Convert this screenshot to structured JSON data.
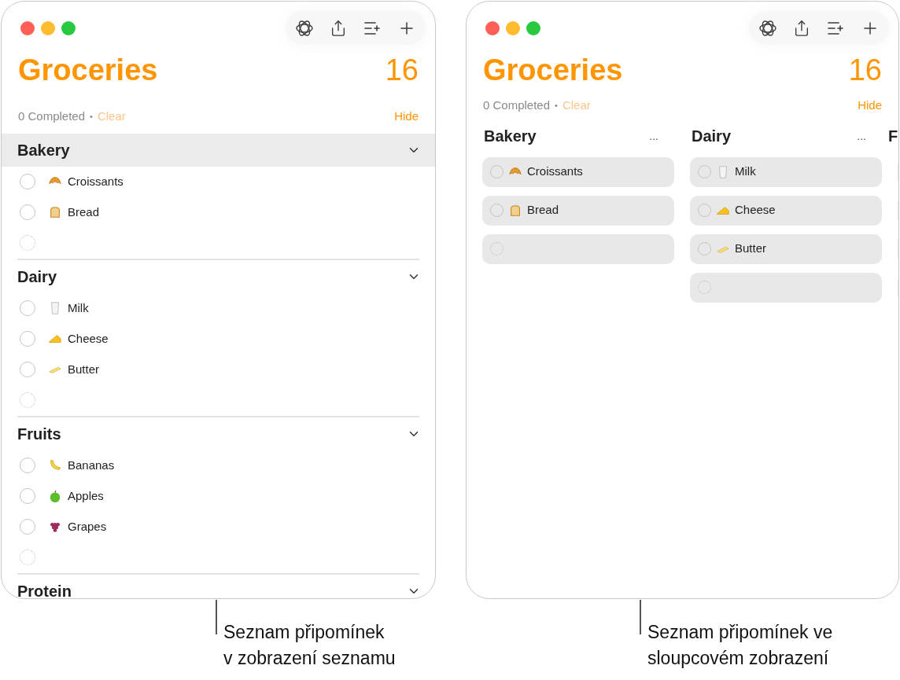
{
  "windows": [
    {
      "kind": "list",
      "title": "Groceries",
      "count": "16",
      "completed": "0 Completed",
      "separator": "•",
      "clear": "Clear",
      "hide": "Hide",
      "sections": [
        {
          "title": "Bakery",
          "selected": true,
          "items": [
            {
              "kind": "croissant",
              "label": "Croissants",
              "checked": false
            },
            {
              "kind": "bread",
              "label": "Bread",
              "checked": false
            },
            {
              "kind": "new"
            }
          ]
        },
        {
          "title": "Dairy",
          "selected": false,
          "items": [
            {
              "kind": "milk",
              "label": "Milk",
              "checked": false
            },
            {
              "kind": "cheese",
              "label": "Cheese",
              "checked": false
            },
            {
              "kind": "butter",
              "label": "Butter",
              "checked": false
            },
            {
              "kind": "new"
            }
          ]
        },
        {
          "title": "Fruits",
          "selected": false,
          "items": [
            {
              "kind": "banana",
              "label": "Bananas",
              "checked": false
            },
            {
              "kind": "apple",
              "label": "Apples",
              "checked": false
            },
            {
              "kind": "grapes",
              "label": "Grapes",
              "checked": false
            },
            {
              "kind": "new"
            }
          ]
        },
        {
          "title": "Protein",
          "selected": false
        }
      ]
    },
    {
      "kind": "columns",
      "title": "Groceries",
      "count": "16",
      "completed": "0 Completed",
      "separator": "•",
      "clear": "Clear",
      "hide": "Hide",
      "sections": [
        {
          "title": "Bakery",
          "more": "...",
          "items": [
            {
              "kind": "croissant",
              "label": "Croissants",
              "checked": false
            },
            {
              "kind": "bread",
              "label": "Bread",
              "checked": false
            },
            {
              "kind": "new"
            }
          ]
        },
        {
          "title": "Dairy",
          "more": "...",
          "items": [
            {
              "kind": "milk",
              "label": "Milk",
              "checked": false
            },
            {
              "kind": "cheese",
              "label": "Cheese",
              "checked": false
            },
            {
              "kind": "butter",
              "label": "Butter",
              "checked": false
            },
            {
              "kind": "new"
            }
          ]
        },
        {
          "title": "F",
          "items": [
            {
              "kind": "cut"
            },
            {
              "kind": "cut"
            },
            {
              "kind": "cut"
            },
            {
              "kind": "cut"
            }
          ]
        }
      ]
    }
  ],
  "captions": [
    "Seznam připomínek\nv zobrazení seznamu",
    "Seznam připomínek ve\nsloupcovém zobrazení"
  ]
}
